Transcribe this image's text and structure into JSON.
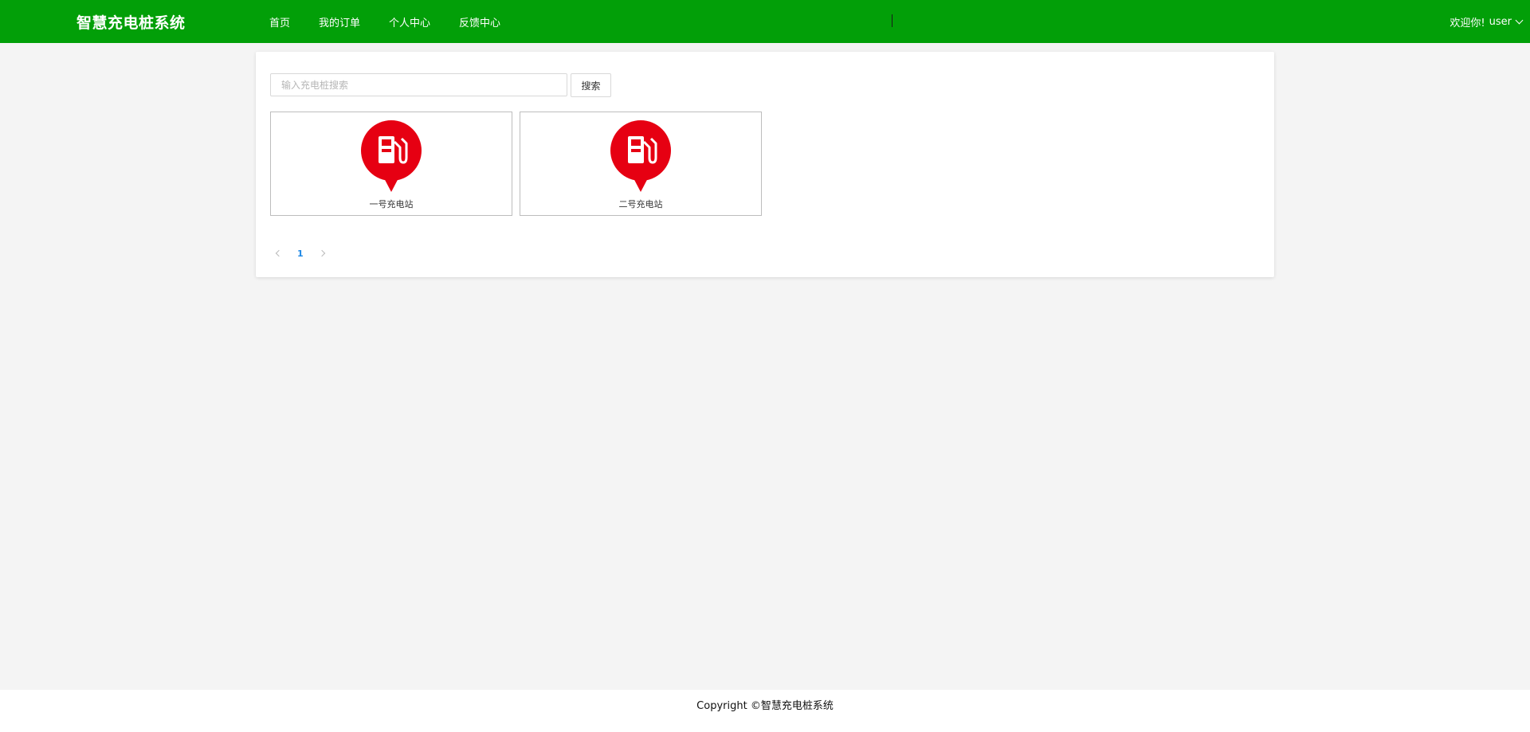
{
  "header": {
    "logo": "智慧充电桩系统",
    "nav": [
      {
        "label": "首页"
      },
      {
        "label": "我的订单"
      },
      {
        "label": "个人中心"
      },
      {
        "label": "反馈中心"
      }
    ],
    "welcome": "欢迎你!",
    "username": "user",
    "bg_color": "#029f08"
  },
  "search": {
    "placeholder": "输入充电桩搜索",
    "value": "",
    "button_label": "搜索"
  },
  "stations": [
    {
      "name": "一号充电站",
      "icon": "charging-station-pin-icon",
      "icon_color": "#e60012"
    },
    {
      "name": "二号充电站",
      "icon": "charging-station-pin-icon",
      "icon_color": "#e60012"
    }
  ],
  "pagination": {
    "current_page": "1"
  },
  "footer": {
    "copyright": "Copyright ©智慧充电桩系统"
  }
}
